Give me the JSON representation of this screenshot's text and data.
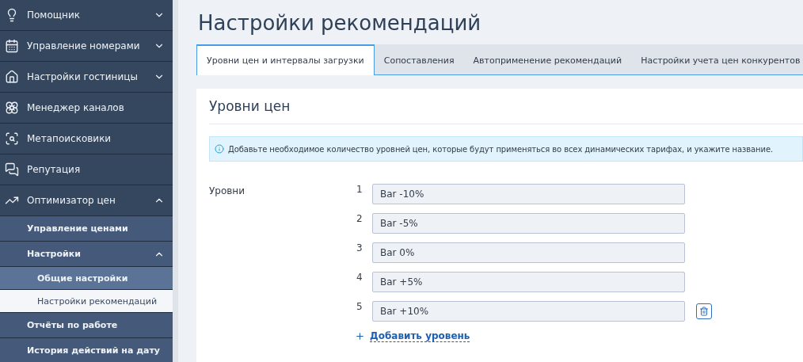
{
  "sidebar": {
    "items": [
      {
        "label": "Помощник",
        "expanded": false,
        "selected": false
      },
      {
        "label": "Управление номерами",
        "expanded": false,
        "selected": false
      },
      {
        "label": "Настройки гостиницы",
        "expanded": false,
        "selected": false
      },
      {
        "label": "Менеджер каналов",
        "selected": false
      },
      {
        "label": "Метапоисковики",
        "selected": false
      },
      {
        "label": "Репутация",
        "selected": false
      },
      {
        "label": "Оптимизатор цен",
        "expanded": true,
        "selected": false,
        "children": [
          {
            "label": "Управление ценами",
            "selected": false
          },
          {
            "label": "Настройки",
            "expanded": true,
            "selected": false,
            "children": [
              {
                "label": "Общие настройки",
                "selected": false
              },
              {
                "label": "Настройки рекомендаций",
                "selected": true
              }
            ]
          },
          {
            "label": "Отчёты по работе",
            "selected": false
          },
          {
            "label": "История действий на дату",
            "selected": false
          }
        ]
      }
    ]
  },
  "page": {
    "title": "Настройки рекомендаций"
  },
  "tabs": [
    {
      "label": "Уровни цен и интервалы загрузки",
      "selected": true
    },
    {
      "label": "Сопоставления",
      "selected": false
    },
    {
      "label": "Автоприменение рекомендаций",
      "selected": false
    },
    {
      "label": "Настройки учета цен конкурентов",
      "selected": false
    }
  ],
  "card": {
    "title": "Уровни цен",
    "info": "Добавьте необходимое количество уровней цен, которые будут применяться во всех динамических тарифах, и укажите название.",
    "levels_label": "Уровни",
    "levels": [
      {
        "number": "1",
        "value": "Bar -10%",
        "deletable": false
      },
      {
        "number": "2",
        "value": "Bar -5%",
        "deletable": false
      },
      {
        "number": "3",
        "value": "Bar 0%",
        "deletable": false
      },
      {
        "number": "4",
        "value": "Bar +5%",
        "deletable": false
      },
      {
        "number": "5",
        "value": "Bar +10%",
        "deletable": true
      }
    ],
    "add_link": "Добавить уровень"
  }
}
